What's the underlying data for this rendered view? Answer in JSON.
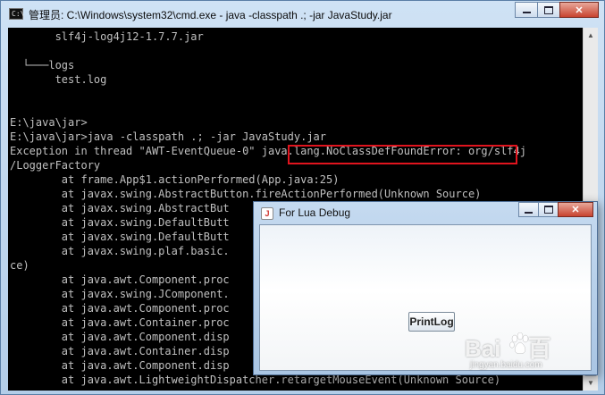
{
  "cmd_window": {
    "icon_label": "C:\\",
    "title": "管理员: C:\\Windows\\system32\\cmd.exe - java  -classpath .; -jar JavaStudy.jar",
    "console_lines": [
      "       slf4j-log4j12-1.7.7.jar",
      "",
      "  └───logs",
      "       test.log",
      "",
      "",
      "E:\\java\\jar>",
      "E:\\java\\jar>java -classpath .; -jar JavaStudy.jar",
      "Exception in thread \"AWT-EventQueue-0\" java.lang.NoClassDefFoundError: org/slf4j",
      "/LoggerFactory",
      "        at frame.App$1.actionPerformed(App.java:25)",
      "        at javax.swing.AbstractButton.fireActionPerformed(Unknown Source)",
      "        at javax.swing.AbstractBut",
      "        at javax.swing.DefaultButt",
      "        at javax.swing.DefaultButt",
      "        at javax.swing.plaf.basic.",
      "ce)",
      "        at java.awt.Component.proc",
      "        at javax.swing.JComponent.",
      "        at java.awt.Component.proc",
      "        at java.awt.Container.proc",
      "        at java.awt.Component.disp",
      "        at java.awt.Container.disp",
      "        at java.awt.Component.disp",
      "        at java.awt.LightweightDispatcher.retargetMouseEvent(Unknown Source)"
    ]
  },
  "swing_window": {
    "icon_label": "J",
    "title": "For Lua Debug",
    "button_label": "PrintLog"
  },
  "window_controls": {
    "minimize_icon": "minimize-icon",
    "maximize_icon": "maximize-icon",
    "close_glyph": "✕"
  },
  "watermark": {
    "logo_left": "Bai",
    "logo_right": "百",
    "sub": "jingyan.baidu.com"
  },
  "colors": {
    "highlight": "#e0141e",
    "console_bg": "#000000",
    "console_fg": "#c0c0c0"
  }
}
